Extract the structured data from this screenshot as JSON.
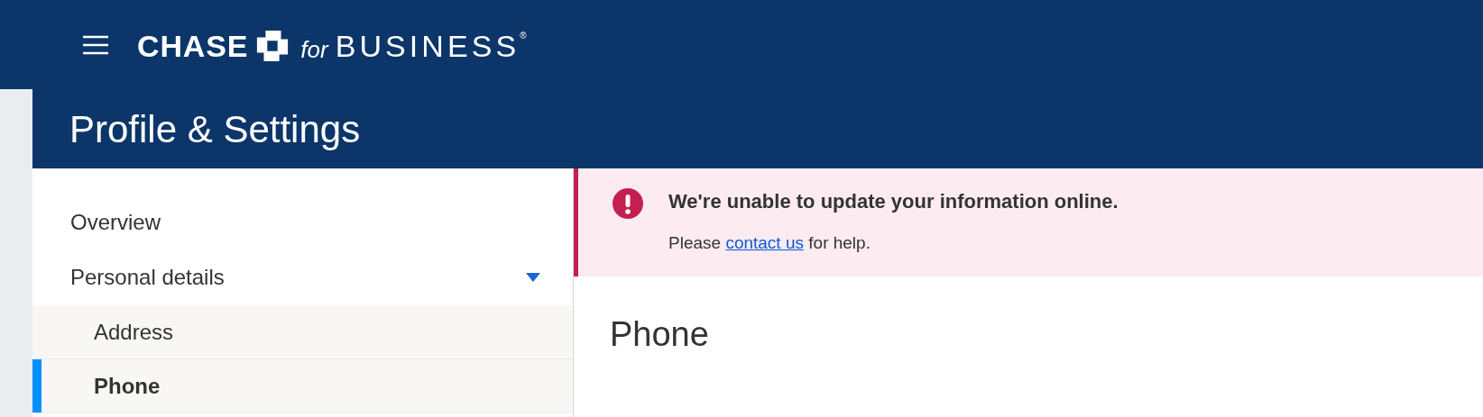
{
  "header": {
    "logo": {
      "brand": "CHASE",
      "for": "for",
      "business": "BUSINESS",
      "mark": "®"
    }
  },
  "page_title": "Profile & Settings",
  "sidebar": {
    "items": [
      {
        "label": "Overview",
        "selected": false
      },
      {
        "label": "Personal details",
        "expanded": true,
        "children": [
          {
            "label": "Address",
            "selected": false
          },
          {
            "label": "Phone",
            "selected": true
          }
        ]
      }
    ]
  },
  "alert": {
    "title": "We're unable to update your information online.",
    "before": "Please",
    "link": "contact us",
    "after": "for help."
  },
  "content": {
    "heading": "Phone"
  }
}
